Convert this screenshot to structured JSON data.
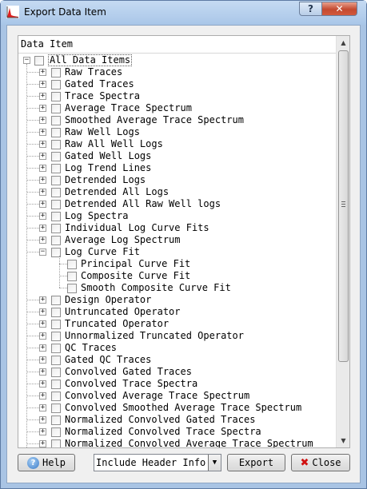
{
  "window": {
    "title": "Export Data Item",
    "help_glyph": "?",
    "close_glyph": "✕"
  },
  "tree": {
    "header": "Data Item",
    "root_label": "All Data Items",
    "items": [
      {
        "label": "Raw Traces",
        "level": 1,
        "expander": "+"
      },
      {
        "label": "Gated Traces",
        "level": 1,
        "expander": "+"
      },
      {
        "label": "Trace Spectra",
        "level": 1,
        "expander": "+"
      },
      {
        "label": "Average Trace Spectrum",
        "level": 1,
        "expander": "+"
      },
      {
        "label": "Smoothed Average Trace Spectrum",
        "level": 1,
        "expander": "+"
      },
      {
        "label": "Raw Well Logs",
        "level": 1,
        "expander": "+"
      },
      {
        "label": "Raw All Well Logs",
        "level": 1,
        "expander": "+"
      },
      {
        "label": "Gated Well Logs",
        "level": 1,
        "expander": "+"
      },
      {
        "label": "Log Trend Lines",
        "level": 1,
        "expander": "+"
      },
      {
        "label": "Detrended Logs",
        "level": 1,
        "expander": "+"
      },
      {
        "label": "Detrended All Logs",
        "level": 1,
        "expander": "+"
      },
      {
        "label": "Detrended All Raw Well logs",
        "level": 1,
        "expander": "+"
      },
      {
        "label": "Log Spectra",
        "level": 1,
        "expander": "+"
      },
      {
        "label": "Individual Log Curve Fits",
        "level": 1,
        "expander": "+"
      },
      {
        "label": "Average Log Spectrum",
        "level": 1,
        "expander": "+"
      },
      {
        "label": "Log Curve Fit",
        "level": 1,
        "expander": "−"
      },
      {
        "label": "Principal Curve Fit",
        "level": 2,
        "expander": ""
      },
      {
        "label": "Composite Curve Fit",
        "level": 2,
        "expander": ""
      },
      {
        "label": "Smooth Composite Curve Fit",
        "level": 2,
        "expander": ""
      },
      {
        "label": "Design Operator",
        "level": 1,
        "expander": "+"
      },
      {
        "label": "Untruncated Operator",
        "level": 1,
        "expander": "+"
      },
      {
        "label": "Truncated Operator",
        "level": 1,
        "expander": "+"
      },
      {
        "label": "Unnormalized Truncated Operator",
        "level": 1,
        "expander": "+"
      },
      {
        "label": "QC Traces",
        "level": 1,
        "expander": "+"
      },
      {
        "label": "Gated QC Traces",
        "level": 1,
        "expander": "+"
      },
      {
        "label": "Convolved Gated Traces",
        "level": 1,
        "expander": "+"
      },
      {
        "label": "Convolved Trace Spectra",
        "level": 1,
        "expander": "+"
      },
      {
        "label": "Convolved Average Trace Spectrum",
        "level": 1,
        "expander": "+"
      },
      {
        "label": "Convolved Smoothed Average Trace Spectrum",
        "level": 1,
        "expander": "+"
      },
      {
        "label": "Normalized Convolved Gated Traces",
        "level": 1,
        "expander": "+"
      },
      {
        "label": "Normalized Convolved Trace Spectra",
        "level": 1,
        "expander": "+"
      },
      {
        "label": "Normalized Convolved Average Trace Spectrum",
        "level": 1,
        "expander": "+"
      }
    ]
  },
  "footer": {
    "help_label": "Help",
    "header_option": "Include Header Info",
    "export_label": "Export",
    "close_label": "Close"
  },
  "icons": {
    "app": "chart-icon",
    "help": "help-icon",
    "close": "x-icon",
    "dropdown": "chevron-down-icon"
  },
  "colors": {
    "title_bar": "#a9c6e8",
    "close_button": "#c44a30",
    "close_x": "#d01010"
  }
}
